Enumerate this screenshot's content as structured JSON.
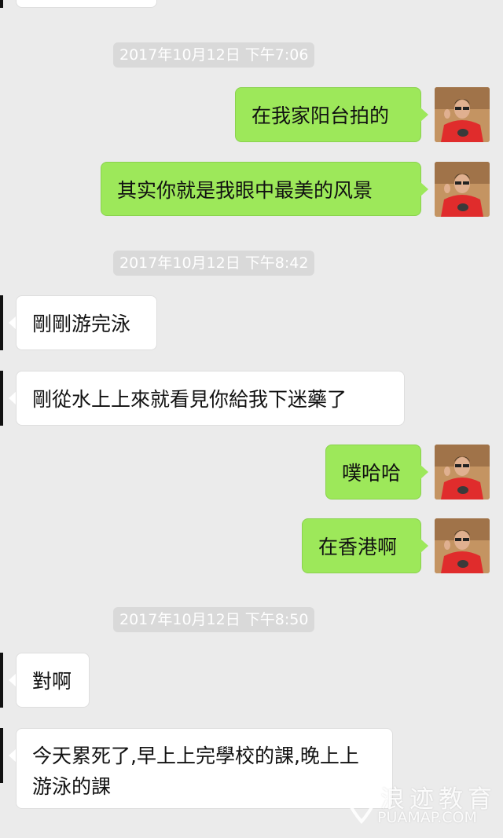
{
  "timestamps": [
    "2017年10月12日 下午7:06",
    "2017年10月12日 下午8:42",
    "2017年10月12日 下午8:50"
  ],
  "messages": [
    {
      "side": "out",
      "text": "在我家阳台拍的"
    },
    {
      "side": "out",
      "text": "其实你就是我眼中最美的风景"
    },
    {
      "side": "in",
      "text": "剛剛游完泳"
    },
    {
      "side": "in",
      "text": "剛從水上上來就看見你給我下迷藥了"
    },
    {
      "side": "out",
      "text": "噗哈哈"
    },
    {
      "side": "out",
      "text": "在香港啊"
    },
    {
      "side": "in",
      "text": "對啊"
    },
    {
      "side": "in",
      "text": "今天累死了,早上上完學校的課,晚上上游泳的課"
    }
  ],
  "watermark": {
    "name": "浪迹教育",
    "domain": "PUAMAP.COM"
  },
  "colors": {
    "background": "#ebebeb",
    "outgoing_bubble": "#9de85a",
    "incoming_bubble": "#ffffff",
    "timestamp_bg": "#d9d9d9"
  },
  "icons": {
    "avatar": "user-avatar",
    "watermark_logo": "location-pin-icon"
  }
}
